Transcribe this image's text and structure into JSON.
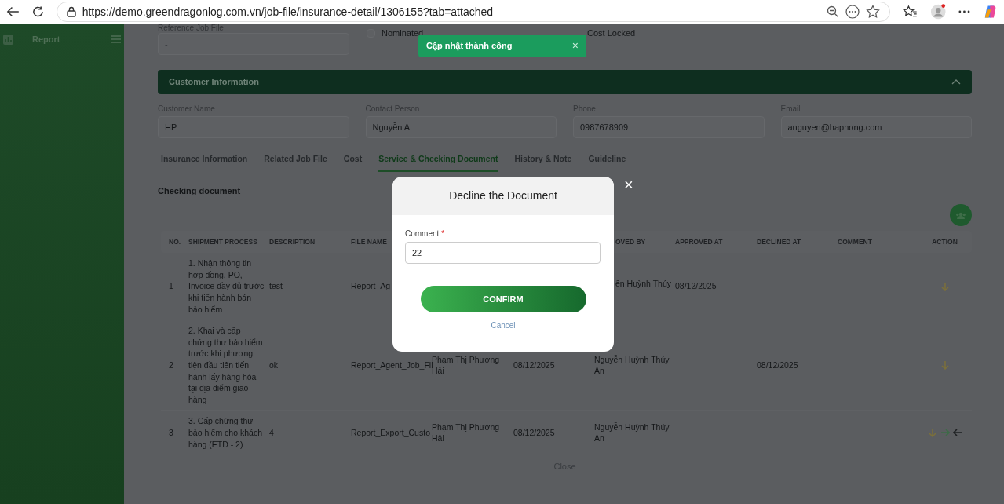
{
  "browser": {
    "url": "https://demo.greendragonlog.com.vn/job-file/insurance-detail/1306155?tab=attached"
  },
  "sidebar": {
    "items": [
      {
        "label": "Report"
      }
    ]
  },
  "reference_job_file": {
    "label": "Reference Job File",
    "value": "-"
  },
  "checkboxes": [
    {
      "label": "Nominated",
      "checked": false
    },
    {
      "label": "Cost Locked"
    }
  ],
  "toast": {
    "message": "Cập nhật thành công",
    "close": "×"
  },
  "customer_section": {
    "title": "Customer Information",
    "expanded": true,
    "fields": [
      {
        "label": "Customer Name",
        "value": "HP"
      },
      {
        "label": "Contact Person",
        "value": "Nguyễn A"
      },
      {
        "label": "Phone",
        "value": "0987678909"
      },
      {
        "label": "Email",
        "value": "anguyen@haphong.com"
      }
    ]
  },
  "tabs": [
    {
      "label": "Insurance Information",
      "selected": false
    },
    {
      "label": "Related Job File",
      "selected": false
    },
    {
      "label": "Cost",
      "selected": false
    },
    {
      "label": "Service & Checking Document",
      "selected": true
    },
    {
      "label": "History & Note",
      "selected": false
    },
    {
      "label": "Guideline",
      "selected": false
    }
  ],
  "section_title": "Checking document",
  "table": {
    "columns": [
      "NO.",
      "SHIPMENT PROCESS",
      "DESCRIPTION",
      "FILE NAME",
      null,
      null,
      "OVED BY",
      "APPROVED AT",
      "DECLINED AT",
      "COMMENT",
      "ACTION"
    ],
    "rows": [
      {
        "cells": [
          "1",
          "1. Nhận thông tin hợp đồng, PO, Invoice đầy đủ trước khi tiến hành bán bảo hiểm",
          "test",
          "Report_Ag",
          null,
          null,
          "ễn Huỳnh Thúy",
          "08/12/2025",
          null,
          null
        ],
        "actions": [
          {
            "kind": "down"
          }
        ]
      },
      {
        "cells": [
          "2",
          "2. Khai và cấp chứng thư bảo hiểm trước khi phương tiện đầu tiên tiến hành lấy hàng hóa tại địa điểm giao hàng",
          "ok",
          "Report_Agent_Job_Fil",
          "Phạm Thị Phương Hải",
          "08/12/2025",
          "Nguyễn Huỳnh Thúy An",
          null,
          "08/12/2025",
          null
        ],
        "actions": [
          {
            "kind": "down"
          }
        ]
      },
      {
        "cells": [
          "3",
          "3. Cấp chứng thư bảo hiểm cho khách hàng (ETD - 2)",
          "4",
          "Report_Export_Custo",
          "Phạm Thị Phương Hải",
          "08/12/2025",
          "Nguyễn Huỳnh Thúy An",
          null,
          null,
          null
        ],
        "actions": [
          {
            "kind": "down"
          },
          {
            "kind": "right"
          },
          {
            "kind": "left"
          }
        ]
      }
    ]
  },
  "close_label": "Close",
  "dialog": {
    "title": "Decline the Document",
    "field": {
      "label": "Comment",
      "required_mark": "*",
      "value": "22"
    },
    "confirm": "CONFIRM",
    "cancel": "Cancel",
    "close": "×"
  }
}
